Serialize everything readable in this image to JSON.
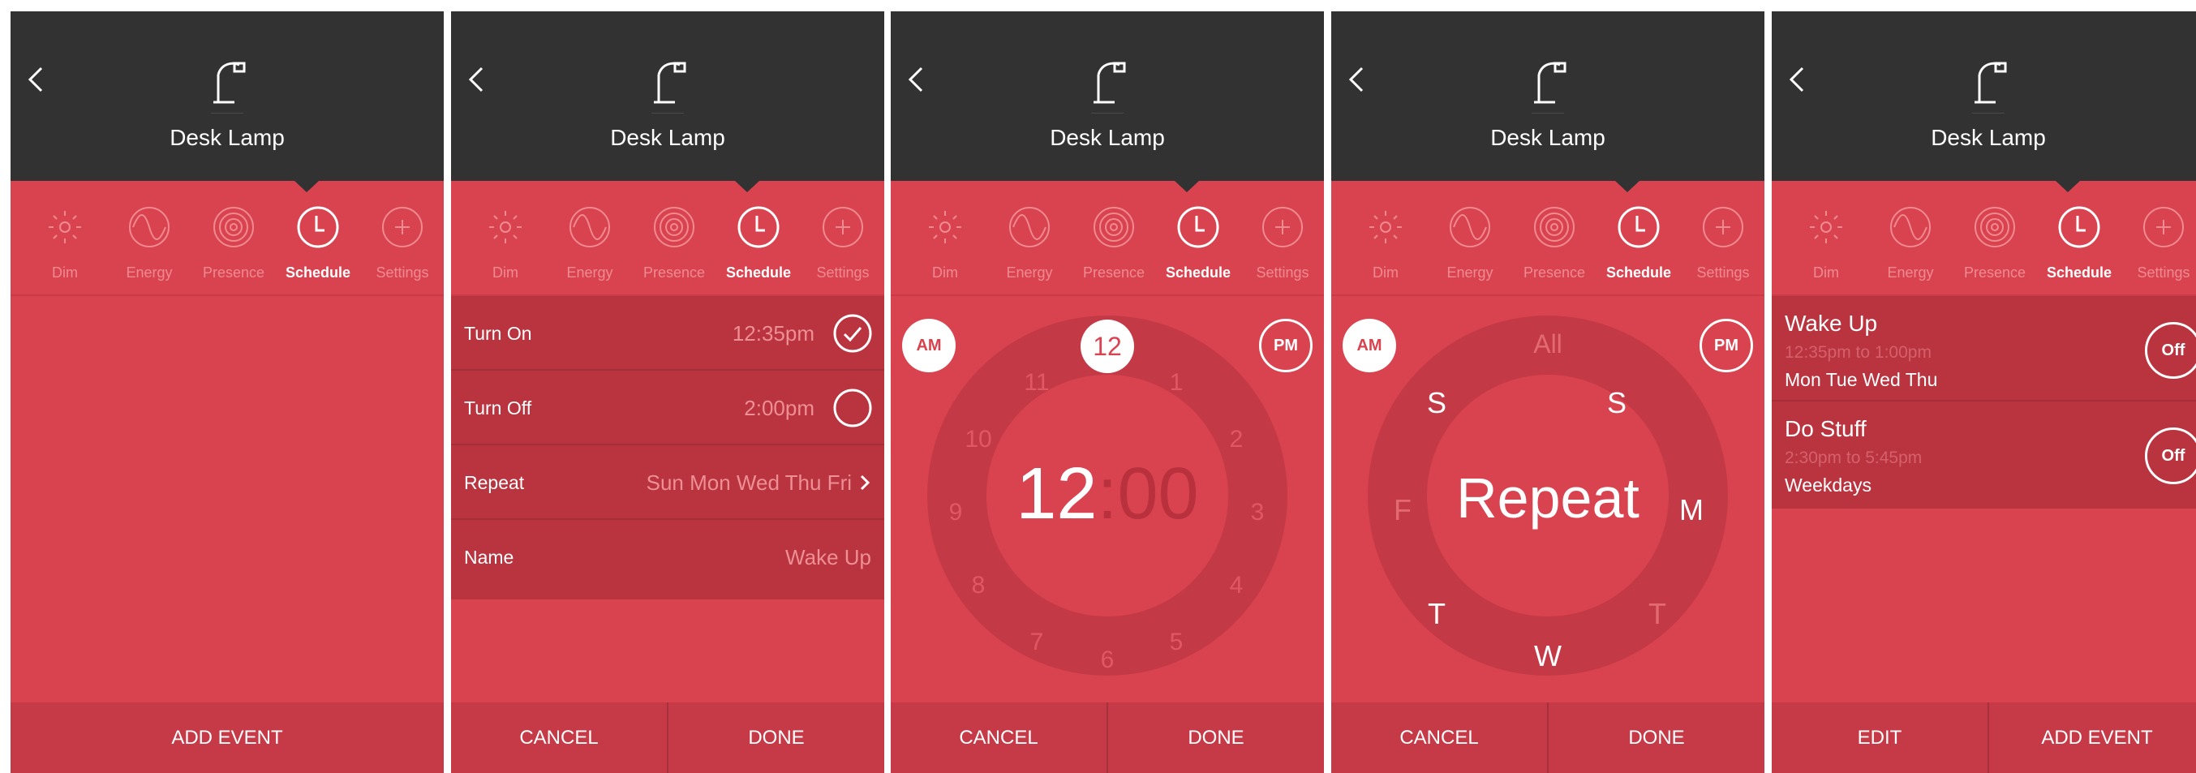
{
  "device": {
    "title": "Desk Lamp",
    "back_icon": "chevron-left-icon",
    "device_icon": "desk-lamp-icon"
  },
  "tabs": [
    {
      "label": "Dim",
      "icon": "sun-icon"
    },
    {
      "label": "Energy",
      "icon": "wave-icon"
    },
    {
      "label": "Presence",
      "icon": "target-icon"
    },
    {
      "label": "Schedule",
      "icon": "clock-icon"
    },
    {
      "label": "Settings",
      "icon": "plus-icon"
    }
  ],
  "active_tab": "Schedule",
  "screen1": {
    "footer": "ADD EVENT"
  },
  "screen2": {
    "rows": [
      {
        "key": "Turn On",
        "value": "12:35pm",
        "checked": true
      },
      {
        "key": "Turn Off",
        "value": "2:00pm",
        "checked": false
      },
      {
        "key": "Repeat",
        "value": "Sun Mon Wed Thu Fri"
      },
      {
        "key": "Name",
        "value": "Wake Up"
      }
    ],
    "cancel": "CANCEL",
    "done": "DONE"
  },
  "screen3": {
    "am": "AM",
    "pm": "PM",
    "selected_hour": "12",
    "hours": [
      "1",
      "2",
      "3",
      "4",
      "5",
      "6",
      "7",
      "8",
      "9",
      "10",
      "11"
    ],
    "time_hours": "12",
    "time_sep": ":",
    "time_minutes": "00",
    "cancel": "CANCEL",
    "done": "DONE"
  },
  "screen4": {
    "am": "AM",
    "pm": "PM",
    "all": "All",
    "days": [
      {
        "label": "S",
        "active": true
      },
      {
        "label": "M",
        "active": true
      },
      {
        "label": "T",
        "active": false
      },
      {
        "label": "W",
        "active": true
      },
      {
        "label": "T",
        "active": true
      },
      {
        "label": "F",
        "active": false
      },
      {
        "label": "S",
        "active": true
      }
    ],
    "center": "Repeat",
    "cancel": "CANCEL",
    "done": "DONE"
  },
  "screen5": {
    "events": [
      {
        "name": "Wake Up",
        "time": "12:35pm to 1:00pm",
        "days": "Mon Tue Wed Thu",
        "toggle": "Off"
      },
      {
        "name": "Do Stuff",
        "time": "2:30pm to 5:45pm",
        "days": "Weekdays",
        "toggle": "Off"
      }
    ],
    "edit": "EDIT",
    "add": "ADD EVENT"
  },
  "colors": {
    "header": "#323232",
    "brand_red": "#d9434f",
    "dark_red": "#b9343f",
    "accent_white": "#ffffff"
  }
}
